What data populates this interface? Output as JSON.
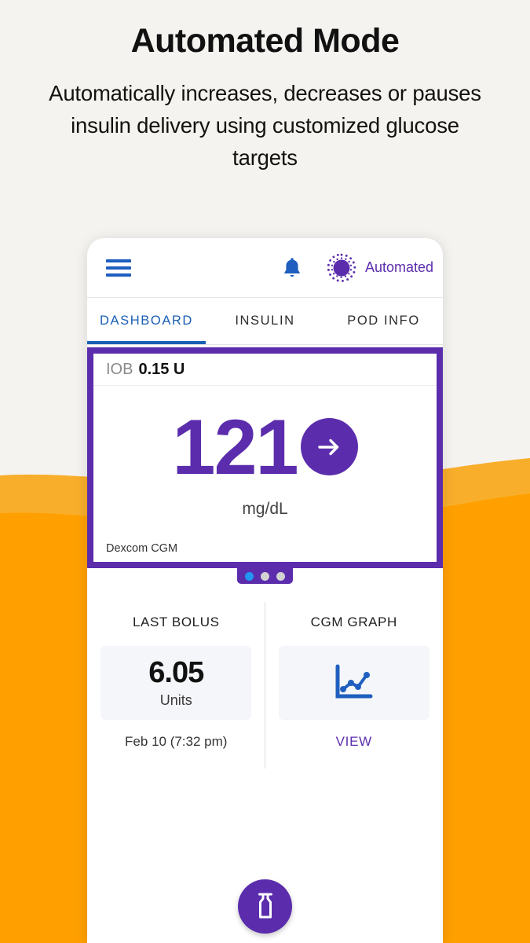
{
  "promo": {
    "title": "Automated Mode",
    "subtitle": "Automatically increases, decreases or pauses insulin delivery using customized glucose targets"
  },
  "colors": {
    "purple": "#5B2DAC",
    "blue": "#1A5FB4",
    "icon_blue": "#1F5FBF",
    "active_dot": "#2196F3",
    "inactive_dot": "#D2D2D2",
    "orange_light": "#F9AE2B",
    "orange_dark": "#FFA000",
    "page_bg": "#F4F3F0",
    "stat_box_bg": "#F5F6FA"
  },
  "appbar": {
    "menu_icon": "hamburger-menu-icon",
    "notification_icon": "bell-icon",
    "mode_icon": "automated-mode-dial-icon",
    "mode_label": "Automated"
  },
  "tabs": [
    {
      "label": "DASHBOARD",
      "active": true
    },
    {
      "label": "INSULIN",
      "active": false
    },
    {
      "label": "POD INFO",
      "active": false
    }
  ],
  "glucose_card": {
    "iob_label": "IOB",
    "iob_value": "0.15 U",
    "reading": "121",
    "units": "mg/dL",
    "source": "Dexcom CGM",
    "arrow_icon": "arrow-right-icon"
  },
  "pager": {
    "total": 3,
    "active_index": 0
  },
  "stats": {
    "last_bolus": {
      "title": "LAST BOLUS",
      "value": "6.05",
      "unit": "Units",
      "timestamp": "Feb 10 (7:32 pm)"
    },
    "cgm_graph": {
      "title": "CGM GRAPH",
      "icon": "line-chart-icon",
      "link_label": "VIEW"
    }
  },
  "fab": {
    "icon": "insulin-vial-icon"
  }
}
